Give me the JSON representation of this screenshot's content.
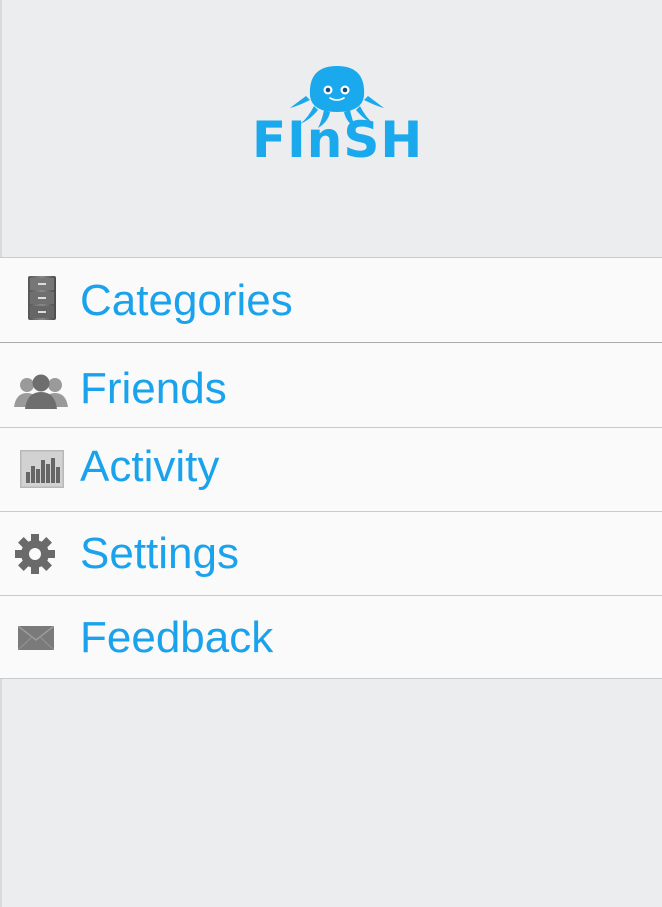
{
  "app": {
    "name": "FInSH",
    "brand_color": "#1aa9ec"
  },
  "menu": {
    "items": [
      {
        "label": "Categories",
        "icon": "file-cabinet-icon"
      },
      {
        "label": "Friends",
        "icon": "people-icon"
      },
      {
        "label": "Activity",
        "icon": "bar-chart-icon"
      },
      {
        "label": "Settings",
        "icon": "gear-icon"
      },
      {
        "label": "Feedback",
        "icon": "envelope-icon"
      }
    ]
  }
}
